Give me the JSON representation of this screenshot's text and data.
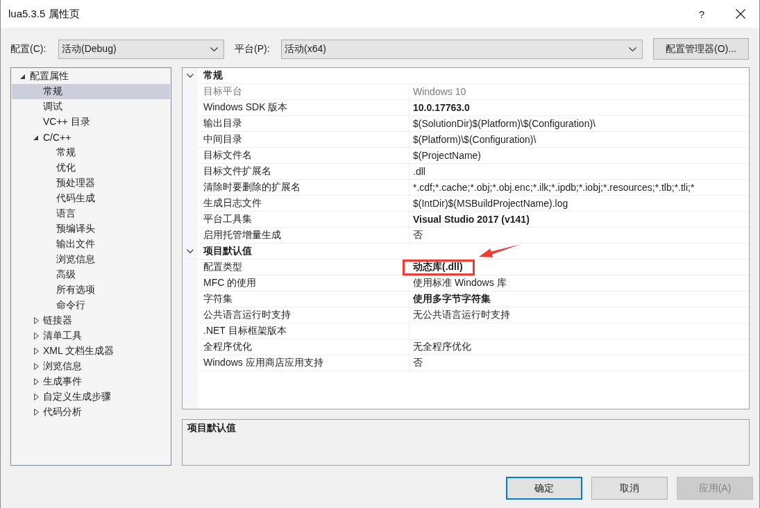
{
  "window": {
    "title": "lua5.3.5 属性页",
    "help_button": "?"
  },
  "config_bar": {
    "configuration": {
      "label": "配置(C):",
      "value": "活动(Debug)"
    },
    "platform": {
      "label": "平台(P):",
      "value": "活动(x64)"
    },
    "manager_button": "配置管理器(O)..."
  },
  "tree": [
    {
      "label": "配置属性",
      "expanded": true,
      "selected": false,
      "children": [
        {
          "label": "常规",
          "selected": true
        },
        {
          "label": "调试",
          "selected": false
        },
        {
          "label": "VC++ 目录",
          "selected": false
        },
        {
          "label": "C/C++",
          "expanded": true,
          "selected": false,
          "children": [
            {
              "label": "常规",
              "selected": false
            },
            {
              "label": "优化",
              "selected": false
            },
            {
              "label": "预处理器",
              "selected": false
            },
            {
              "label": "代码生成",
              "selected": false
            },
            {
              "label": "语言",
              "selected": false
            },
            {
              "label": "预编译头",
              "selected": false
            },
            {
              "label": "输出文件",
              "selected": false
            },
            {
              "label": "浏览信息",
              "selected": false
            },
            {
              "label": "高级",
              "selected": false
            },
            {
              "label": "所有选项",
              "selected": false
            },
            {
              "label": "命令行",
              "selected": false
            }
          ]
        },
        {
          "label": "链接器",
          "expanded": false,
          "selected": false
        },
        {
          "label": "清单工具",
          "expanded": false,
          "selected": false
        },
        {
          "label": "XML 文档生成器",
          "expanded": false,
          "selected": false
        },
        {
          "label": "浏览信息",
          "expanded": false,
          "selected": false
        },
        {
          "label": "生成事件",
          "expanded": false,
          "selected": false
        },
        {
          "label": "自定义生成步骤",
          "expanded": false,
          "selected": false
        },
        {
          "label": "代码分析",
          "expanded": false,
          "selected": false
        }
      ]
    }
  ],
  "property_grid": {
    "categories": [
      {
        "title": "常规",
        "expanded": true,
        "properties": [
          {
            "name": "目标平台",
            "value": "Windows 10",
            "disabled": true,
            "bold": false,
            "highlighted": false
          },
          {
            "name": "Windows SDK 版本",
            "value": "10.0.17763.0",
            "disabled": false,
            "bold": true,
            "highlighted": false
          },
          {
            "name": "输出目录",
            "value": "$(SolutionDir)$(Platform)\\$(Configuration)\\",
            "disabled": false,
            "bold": false,
            "highlighted": false
          },
          {
            "name": "中间目录",
            "value": "$(Platform)\\$(Configuration)\\",
            "disabled": false,
            "bold": false,
            "highlighted": false
          },
          {
            "name": "目标文件名",
            "value": "$(ProjectName)",
            "disabled": false,
            "bold": false,
            "highlighted": false
          },
          {
            "name": "目标文件扩展名",
            "value": ".dll",
            "disabled": false,
            "bold": false,
            "highlighted": false
          },
          {
            "name": "清除时要删除的扩展名",
            "value": "*.cdf;*.cache;*.obj;*.obj.enc;*.ilk;*.ipdb;*.iobj;*.resources;*.tlb;*.tli;*",
            "disabled": false,
            "bold": false,
            "highlighted": false
          },
          {
            "name": "生成日志文件",
            "value": "$(IntDir)$(MSBuildProjectName).log",
            "disabled": false,
            "bold": false,
            "highlighted": false
          },
          {
            "name": "平台工具集",
            "value": "Visual Studio 2017 (v141)",
            "disabled": false,
            "bold": true,
            "highlighted": false
          },
          {
            "name": "启用托管增量生成",
            "value": "否",
            "disabled": false,
            "bold": false,
            "highlighted": false
          }
        ]
      },
      {
        "title": "项目默认值",
        "expanded": true,
        "properties": [
          {
            "name": "配置类型",
            "value": "动态库(.dll)",
            "disabled": false,
            "bold": true,
            "highlighted": true
          },
          {
            "name": "MFC 的使用",
            "value": "使用标准 Windows 库",
            "disabled": false,
            "bold": false,
            "highlighted": false
          },
          {
            "name": "字符集",
            "value": "使用多字节字符集",
            "disabled": false,
            "bold": true,
            "highlighted": false
          },
          {
            "name": "公共语言运行时支持",
            "value": "无公共语言运行时支持",
            "disabled": false,
            "bold": false,
            "highlighted": false
          },
          {
            "name": ".NET 目标框架版本",
            "disabled": false
          },
          {
            "name": "全程序优化",
            "value": "无全程序优化",
            "disabled": false,
            "bold": false,
            "highlighted": false
          },
          {
            "name": "Windows 应用商店应用支持",
            "value": "否",
            "disabled": false,
            "bold": false,
            "highlighted": false
          }
        ]
      }
    ]
  },
  "description": {
    "title": "项目默认值"
  },
  "buttons": [
    {
      "label": "确定",
      "kind": "default",
      "disabled": false
    },
    {
      "label": "取消",
      "kind": "normal",
      "disabled": false
    },
    {
      "label": "应用(A)",
      "kind": "normal",
      "disabled": true
    }
  ]
}
